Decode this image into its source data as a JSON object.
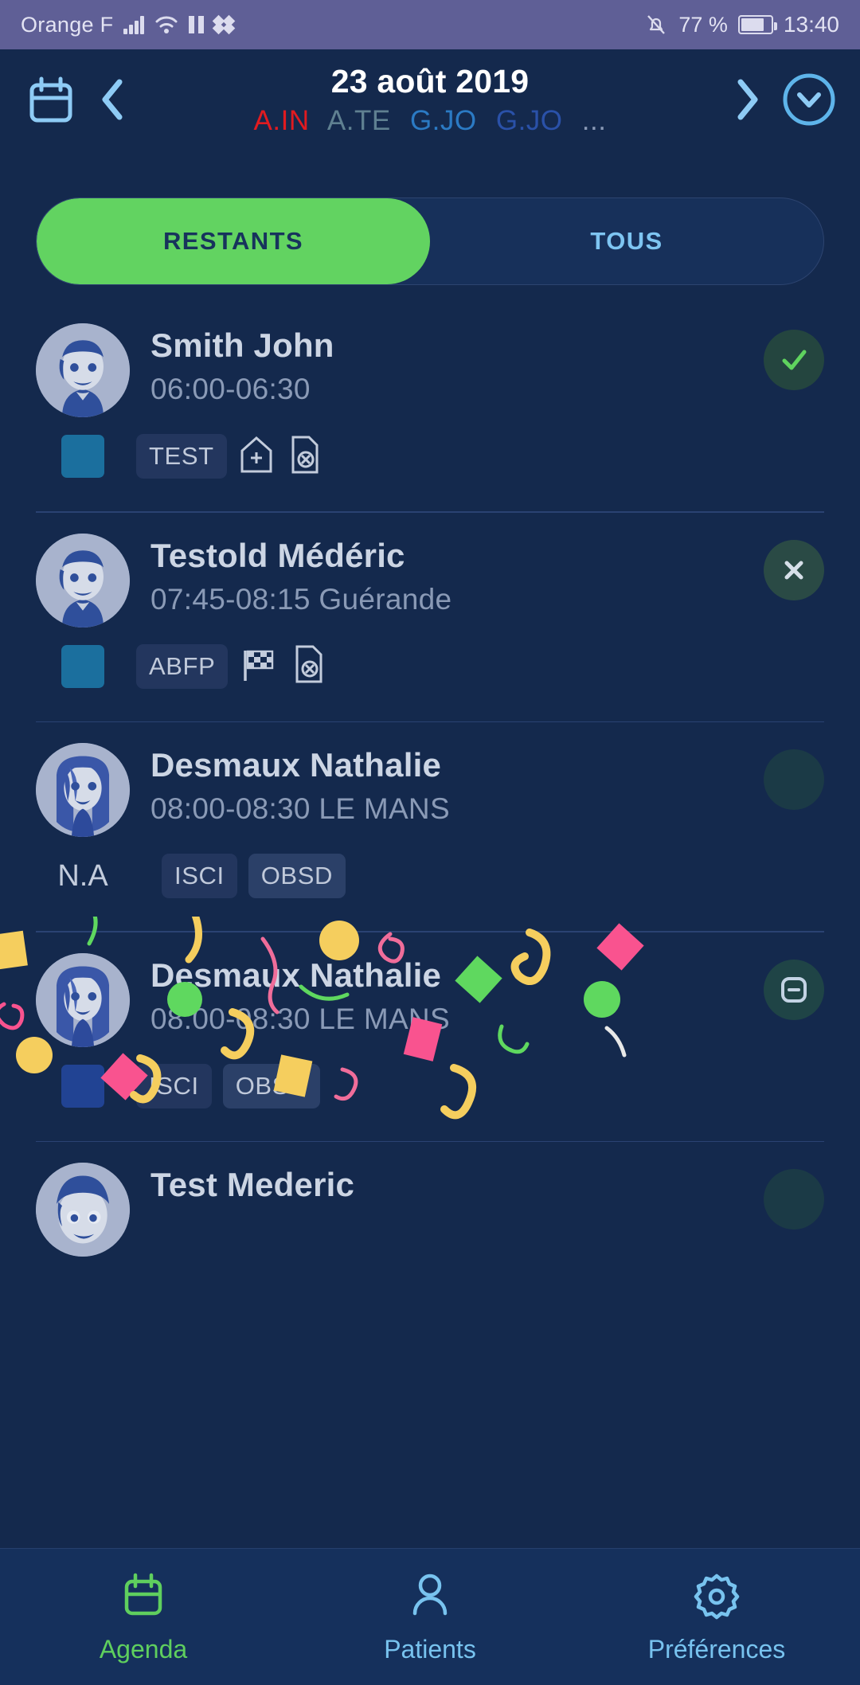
{
  "status_bar": {
    "carrier": "Orange F",
    "battery_percent": "77 %",
    "clock": "13:40",
    "icons": [
      "signal-icon",
      "wifi-icon",
      "pause-icon",
      "dropbox-icon",
      "bell-off-icon",
      "battery-icon"
    ]
  },
  "header": {
    "calendar_icon": "calendar-icon",
    "prev_label": "‹",
    "next_label": "›",
    "date": "23 août 2019",
    "expand_icon": "chevron-down-circle-icon",
    "tags": [
      {
        "label": "A.IN",
        "color": "#e01b20"
      },
      {
        "label": "A.TE",
        "color": "#5f8091"
      },
      {
        "label": "G.JO",
        "color": "#2b7ac4"
      },
      {
        "label": "G.JO",
        "color": "#2a51a8"
      },
      {
        "label": "...",
        "color": "#8a9ab6"
      }
    ]
  },
  "segmented": {
    "active_label": "RESTANTS",
    "inactive_label": "TOUS",
    "active_color": "#62d361",
    "inactive_text_color": "#7ec5f2"
  },
  "appointments": [
    {
      "name": "Smith John",
      "meta": "06:00-06:30",
      "avatar": "male",
      "color_chip": "#1b6f9e",
      "na_label": null,
      "tags": [
        "TEST"
      ],
      "icons": [
        "clinic-icon",
        "document-cancel-icon"
      ],
      "status": "check",
      "confetti": false
    },
    {
      "name": "Testold Médéric",
      "meta": "07:45-08:15 Guérande",
      "avatar": "male",
      "color_chip": "#1b6f9e",
      "na_label": null,
      "tags": [
        "ABFP"
      ],
      "icons": [
        "checkered-flag-icon",
        "document-cancel-icon"
      ],
      "status": "cross",
      "confetti": false
    },
    {
      "name": "Desmaux Nathalie",
      "meta": "08:00-08:30 LE MANS",
      "avatar": "female",
      "color_chip": null,
      "na_label": "N.A",
      "tags": [
        "ISCI",
        "OBSD"
      ],
      "icons": [],
      "status": "empty",
      "confetti": false
    },
    {
      "name": "Desmaux Nathalie",
      "meta": "08:00-08:30 LE MANS",
      "avatar": "female",
      "color_chip": "#214393",
      "na_label": null,
      "tags": [
        "ISCI",
        "OBSD"
      ],
      "icons": [],
      "status": "minus",
      "confetti": true
    },
    {
      "name": "Test Mederic",
      "meta": "",
      "avatar": "child",
      "color_chip": null,
      "na_label": null,
      "tags": [],
      "icons": [],
      "status": "empty",
      "confetti": false
    }
  ],
  "bottom_nav": [
    {
      "label": "Agenda",
      "icon": "calendar-icon",
      "active": true
    },
    {
      "label": "Patients",
      "icon": "person-icon",
      "active": false
    },
    {
      "label": "Préférences",
      "icon": "gear-icon",
      "active": false
    }
  ],
  "confetti_colors": {
    "yellow": "#f5ce5e",
    "pink": "#f9538f",
    "green": "#5fd85f",
    "white": "#e8e8e8"
  }
}
